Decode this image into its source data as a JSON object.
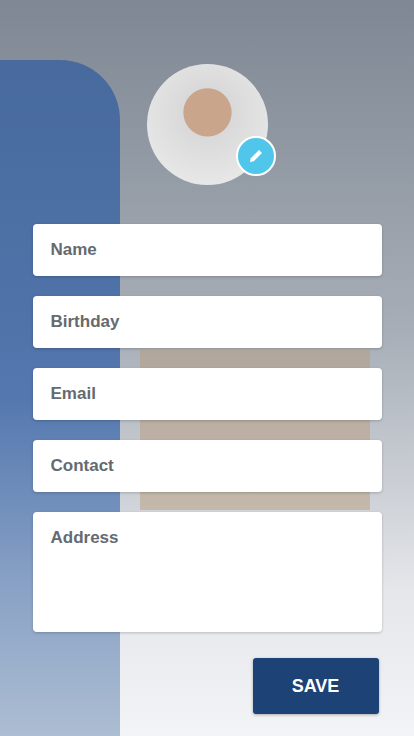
{
  "profile": {
    "avatar_editable": true
  },
  "fields": [
    {
      "label": "Name",
      "kind": "input"
    },
    {
      "label": "Birthday",
      "kind": "input"
    },
    {
      "label": "Email",
      "kind": "input"
    },
    {
      "label": "Contact",
      "kind": "input"
    },
    {
      "label": "Address",
      "kind": "textarea"
    }
  ],
  "buttons": [
    "SAVE"
  ]
}
